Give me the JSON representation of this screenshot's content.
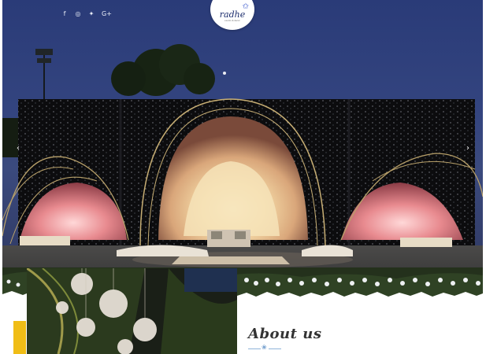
{
  "header": {
    "social_links": [
      {
        "name": "facebook",
        "glyph": "f"
      },
      {
        "name": "instagram",
        "glyph": "◎"
      },
      {
        "name": "twitter",
        "glyph": "✦"
      },
      {
        "name": "google-plus",
        "glyph": "G+"
      }
    ],
    "logo": {
      "word": "radhe",
      "star": "✩",
      "tagline": "events & decor"
    }
  },
  "hero": {
    "prev_arrow": "‹",
    "next_arrow": "›"
  },
  "about": {
    "heading": "About us",
    "divider_icon": "❀"
  },
  "colors": {
    "sky": "#33447f",
    "accent_yellow": "#f0bd16",
    "heading": "#333333",
    "divider": "#8fb3d9"
  }
}
